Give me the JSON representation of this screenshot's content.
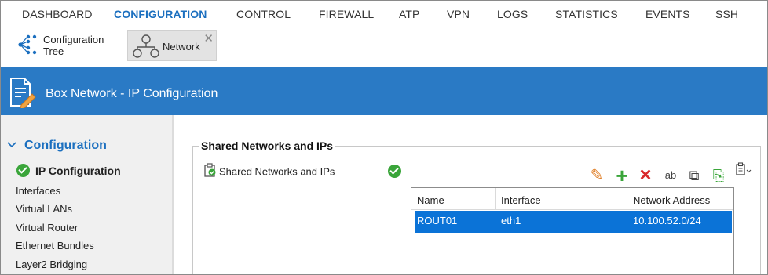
{
  "topnav": {
    "items": [
      {
        "label": "DASHBOARD"
      },
      {
        "label": "CONFIGURATION"
      },
      {
        "label": "CONTROL"
      },
      {
        "label": "FIREWALL"
      },
      {
        "label": "ATP"
      },
      {
        "label": "VPN"
      },
      {
        "label": "LOGS"
      },
      {
        "label": "STATISTICS"
      },
      {
        "label": "EVENTS"
      },
      {
        "label": "SSH"
      }
    ],
    "active_index": 1,
    "accent_color": "#1b6fbf"
  },
  "tabs": {
    "config_tree": {
      "line1": "Configuration",
      "line2": "Tree",
      "icon": "tree-structure-icon"
    },
    "network": {
      "label": "Network",
      "icon": "network-topology-icon",
      "close": "✕"
    }
  },
  "header": {
    "title": "Box Network - IP Configuration",
    "icon": "edit-document-icon",
    "background_color": "#2a7ac5"
  },
  "sidebar": {
    "section": "Configuration",
    "items": [
      {
        "label": "IP Configuration",
        "active": true
      },
      {
        "label": "Interfaces"
      },
      {
        "label": "Virtual LANs"
      },
      {
        "label": "Virtual Router"
      },
      {
        "label": "Ethernet Bundles"
      },
      {
        "label": "Layer2 Bridging"
      }
    ]
  },
  "main": {
    "group_title": "Shared Networks and IPs",
    "row_label": "Shared Networks and IPs",
    "row_status": "ok",
    "toolbar": [
      {
        "name": "edit-icon",
        "glyph": "✎",
        "color": "#e0812b"
      },
      {
        "name": "add-icon",
        "glyph": "+",
        "color": "#3aa53a"
      },
      {
        "name": "delete-icon",
        "glyph": "✕",
        "color": "#d9292b"
      },
      {
        "name": "rename-icon",
        "glyph": "ab",
        "color": "#444444"
      },
      {
        "name": "copy-icon",
        "glyph": "⧉",
        "color": "#444444"
      },
      {
        "name": "paste-icon",
        "glyph": "⎘",
        "color": "#3aa53a"
      },
      {
        "name": "clipboard-menu-icon",
        "glyph": "📋",
        "color": "#444444"
      }
    ],
    "table": {
      "columns": [
        "Name",
        "Interface",
        "Network Address"
      ],
      "rows": [
        {
          "name": "ROUT01",
          "interface": "eth1",
          "network_address": "10.100.52.0/24",
          "selected": true
        }
      ],
      "selection_color": "#0b73d7"
    }
  }
}
